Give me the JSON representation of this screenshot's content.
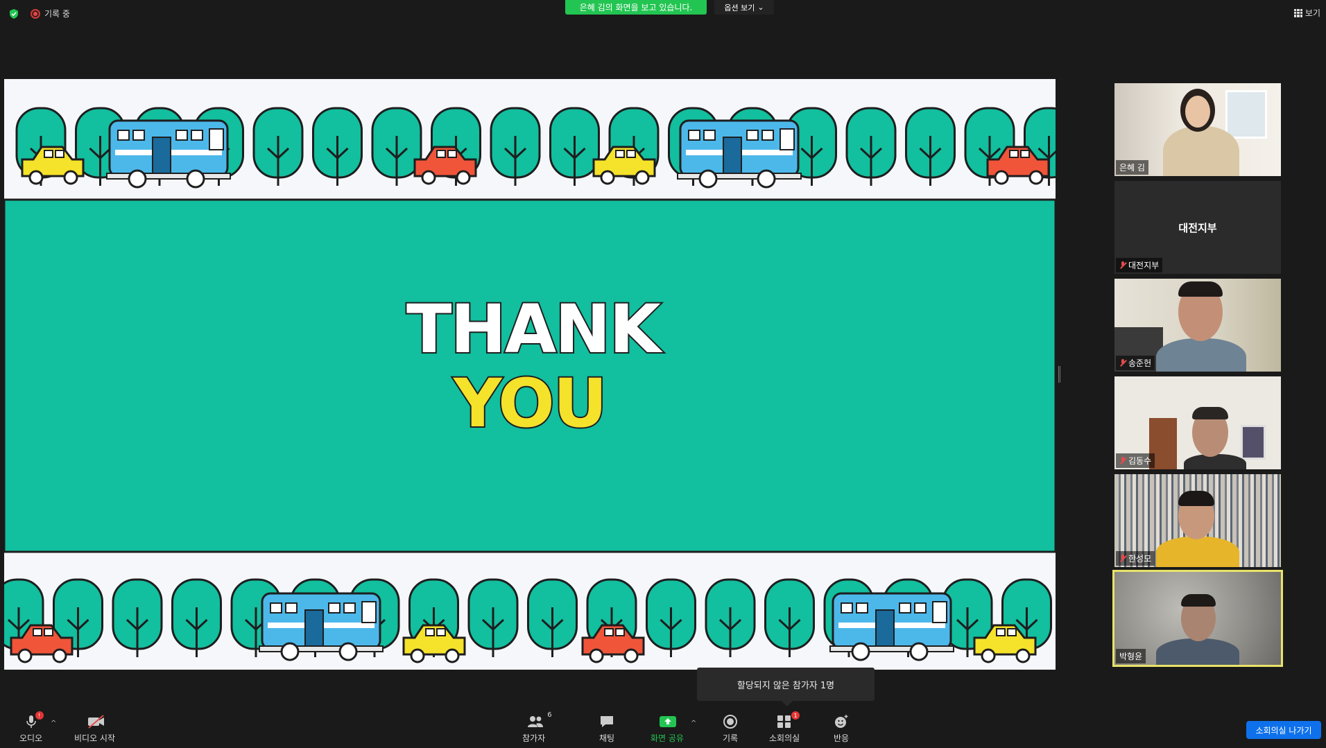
{
  "topbar": {
    "recording_label": "기록 중",
    "sharing_banner": "은혜 김의 화면을 보고 있습니다.",
    "view_options_label": "옵션 보기",
    "view_label": "보기"
  },
  "slide": {
    "line1": "THANK",
    "line2": "YOU",
    "colors": {
      "teal": "#12bf9f",
      "yellow": "#f5e22a",
      "red": "#f0553a",
      "blue": "#4cb8ea",
      "outline": "#1e1e1e"
    }
  },
  "participants": [
    {
      "name": "은혜 김",
      "muted": false,
      "video": true
    },
    {
      "name": "대전지부",
      "muted": true,
      "video": false,
      "tile_label": "대전지부"
    },
    {
      "name": "송준헌",
      "muted": true,
      "video": true
    },
    {
      "name": "김동수",
      "muted": true,
      "video": true
    },
    {
      "name": "한성모",
      "muted": true,
      "video": true
    },
    {
      "name": "박형윤",
      "muted": false,
      "video": true,
      "active_speaker": true
    }
  ],
  "tooltip": {
    "text": "할당되지 않은 참가자 1명"
  },
  "toolbar": {
    "audio": {
      "label": "오디오",
      "badge": "!"
    },
    "video": {
      "label": "비디오 시작"
    },
    "participants": {
      "label": "참가자",
      "count": "6"
    },
    "chat": {
      "label": "채팅"
    },
    "share": {
      "label": "화면 공유"
    },
    "record": {
      "label": "기록"
    },
    "breakout": {
      "label": "소회의실",
      "badge": "1"
    },
    "reactions": {
      "label": "반응"
    },
    "leave_breakout": {
      "label": "소회의실 나가기"
    }
  }
}
